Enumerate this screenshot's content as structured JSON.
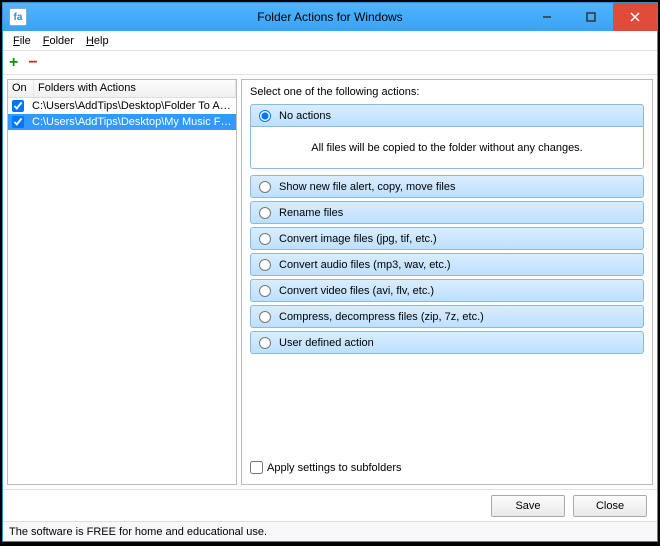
{
  "window": {
    "title": "Folder Actions for Windows",
    "app_icon_text": "fa"
  },
  "menu": {
    "file": "File",
    "folder": "Folder",
    "help": "Help"
  },
  "toolbar": {
    "add": "+",
    "remove": "−"
  },
  "columns": {
    "on": "On",
    "path": "Folders with Actions"
  },
  "folders": [
    {
      "checked": true,
      "path": "C:\\Users\\AddTips\\Desktop\\Folder To Actions Tes...",
      "selected": false
    },
    {
      "checked": true,
      "path": "C:\\Users\\AddTips\\Desktop\\My Music Folder",
      "selected": true
    }
  ],
  "right": {
    "prompt": "Select one of the following actions:",
    "description": "All files will be copied to the folder without any changes.",
    "subfolders_label": "Apply settings to subfolders",
    "save": "Save",
    "close": "Close"
  },
  "actions": [
    {
      "label": "No actions",
      "selected": true
    },
    {
      "label": "Show new file alert, copy, move files",
      "selected": false
    },
    {
      "label": "Rename files",
      "selected": false
    },
    {
      "label": "Convert image files (jpg, tif, etc.)",
      "selected": false
    },
    {
      "label": "Convert audio files (mp3, wav, etc.)",
      "selected": false
    },
    {
      "label": "Convert video files (avi, flv, etc.)",
      "selected": false
    },
    {
      "label": "Compress, decompress files (zip, 7z, etc.)",
      "selected": false
    },
    {
      "label": "User defined action",
      "selected": false
    }
  ],
  "status": "The software is FREE for home and educational use."
}
